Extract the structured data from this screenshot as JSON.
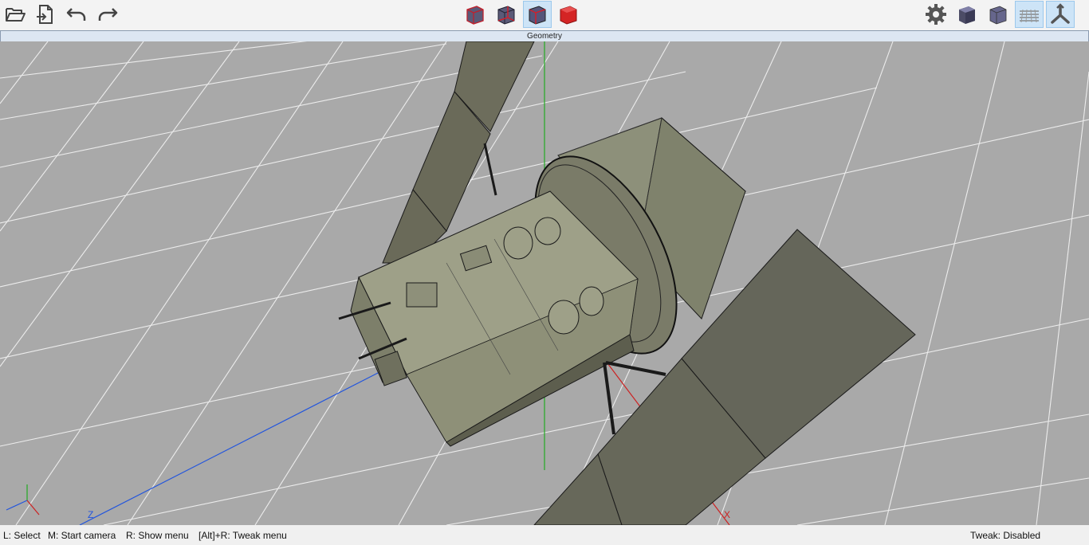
{
  "toolbar": {
    "left": [
      {
        "name": "open-folder-icon"
      },
      {
        "name": "import-icon"
      },
      {
        "name": "undo-icon"
      },
      {
        "name": "redo-icon"
      }
    ],
    "view_modes": [
      {
        "name": "wireframe-cube-icon",
        "active": false
      },
      {
        "name": "wireframe-red-edges-icon",
        "active": false
      },
      {
        "name": "shaded-wireframe-cube-icon",
        "active": true
      },
      {
        "name": "solid-red-cube-icon",
        "active": false
      }
    ],
    "right": [
      {
        "name": "settings-gear-icon",
        "active": false
      },
      {
        "name": "smooth-shading-icon",
        "active": false
      },
      {
        "name": "flat-shading-icon",
        "active": false
      },
      {
        "name": "ground-grid-icon",
        "active": true
      },
      {
        "name": "axes-icon",
        "active": true
      }
    ]
  },
  "panel": {
    "title": "Geometry"
  },
  "viewport": {
    "background": "#a9a9a9",
    "axis_labels": {
      "x": "X",
      "z": "Z"
    },
    "axis_colors": {
      "x": "#cc2222",
      "y": "#22aa22",
      "z": "#2255dd"
    }
  },
  "statusbar": {
    "select": "L: Select",
    "camera": "M: Start camera",
    "menu": "R: Show menu",
    "tweak_menu": "[Alt]+R: Tweak menu",
    "tweak_status": "Tweak: Disabled"
  }
}
